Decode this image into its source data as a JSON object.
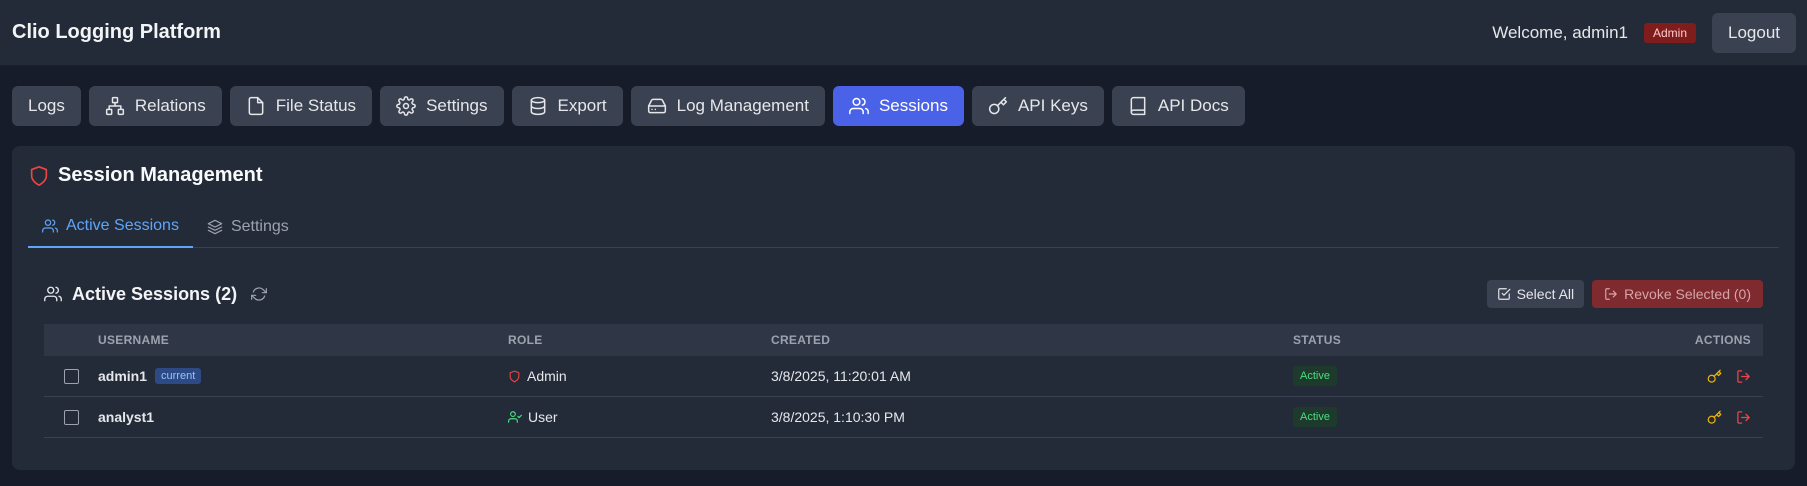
{
  "app": {
    "title": "Clio Logging Platform"
  },
  "header": {
    "welcome": "Welcome, admin1",
    "role_badge": "Admin",
    "logout_label": "Logout"
  },
  "nav": [
    {
      "label": "Logs",
      "icon": "none"
    },
    {
      "label": "Relations",
      "icon": "network-icon"
    },
    {
      "label": "File Status",
      "icon": "file-icon"
    },
    {
      "label": "Settings",
      "icon": "gear-icon"
    },
    {
      "label": "Export",
      "icon": "database-icon"
    },
    {
      "label": "Log Management",
      "icon": "hard-drive-icon"
    },
    {
      "label": "Sessions",
      "icon": "users-icon",
      "active": true
    },
    {
      "label": "API Keys",
      "icon": "key-icon"
    },
    {
      "label": "API Docs",
      "icon": "book-icon"
    }
  ],
  "panel": {
    "title": "Session Management",
    "tabs": [
      {
        "label": "Active Sessions",
        "active": true
      },
      {
        "label": "Settings",
        "active": false
      }
    ],
    "sessions_title": "Active Sessions (2)",
    "select_all_label": "Select All",
    "revoke_label": "Revoke Selected (0)"
  },
  "table": {
    "headers": [
      "USERNAME",
      "ROLE",
      "CREATED",
      "STATUS",
      "ACTIONS"
    ],
    "rows": [
      {
        "username": "admin1",
        "badge": "current",
        "role": "Admin",
        "created": "3/8/2025, 11:20:01 AM",
        "status": "Active"
      },
      {
        "username": "analyst1",
        "badge": "",
        "role": "User",
        "created": "3/8/2025, 1:10:30 PM",
        "status": "Active"
      }
    ]
  },
  "colors": {
    "accent": "#4a62e8",
    "admin_badge": "#7f1d1d",
    "status_active": "#4ade80",
    "key_action": "#eab308",
    "logout_action": "#ef4444"
  }
}
